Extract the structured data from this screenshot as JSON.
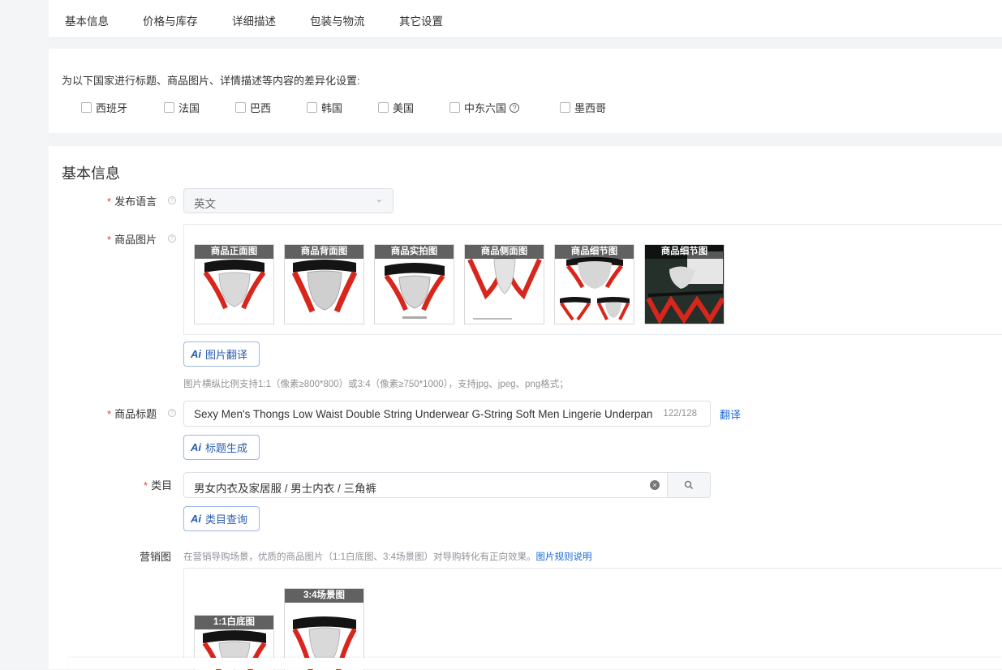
{
  "tabs": [
    "基本信息",
    "价格与库存",
    "详细描述",
    "包装与物流",
    "其它设置"
  ],
  "localization": {
    "intro": "为以下国家进行标题、商品图片、详情描述等内容的差异化设置:",
    "countries": [
      "西班牙",
      "法国",
      "巴西",
      "韩国",
      "美国",
      "中东六国",
      "墨西哥"
    ],
    "info_icon": "question-circle-icon"
  },
  "basic_info": {
    "section_title": "基本信息",
    "required_mark": "*",
    "help_icon": "question-circle-icon",
    "language": {
      "label": "发布语言",
      "value": "英文",
      "icon": "chevron-down-icon"
    },
    "images": {
      "label": "商品图片",
      "thumbnails": [
        "商品正面图",
        "商品背面图",
        "商品实拍图",
        "商品侧面图",
        "商品细节图",
        "商品细节图"
      ],
      "translate_button": "图片翻译",
      "hint": "图片横纵比例支持1:1（像素≥800*800）或3:4（像素≥750*1000），支持jpg、jpeg、png格式；"
    },
    "title": {
      "label": "商品标题",
      "value": "Sexy Men's Thongs Low Waist Double String Underwear G-String Soft Men Lingerie Underpants",
      "count": "122/128",
      "translate_link": "翻译",
      "generate_button": "标题生成"
    },
    "category": {
      "label": "类目",
      "value": "男女内衣及家居服 / 男士内衣 / 三角裤",
      "query_button": "类目查询",
      "clear_icon": "clear-circle-icon",
      "search_icon": "search-icon"
    },
    "marketing": {
      "label": "营销图",
      "hint": "在营销导购场景，优质的商品图片（1:1白底图、3:4场景图）对导购转化有正向效果。",
      "rules_link": "图片规则说明",
      "images": [
        "1:1白底图",
        "3:4场景图"
      ]
    },
    "ai_badge": "Ai"
  },
  "colors": {
    "required": "#e4393c",
    "link": "#1a6ad0",
    "product_red": "#d8261c"
  }
}
